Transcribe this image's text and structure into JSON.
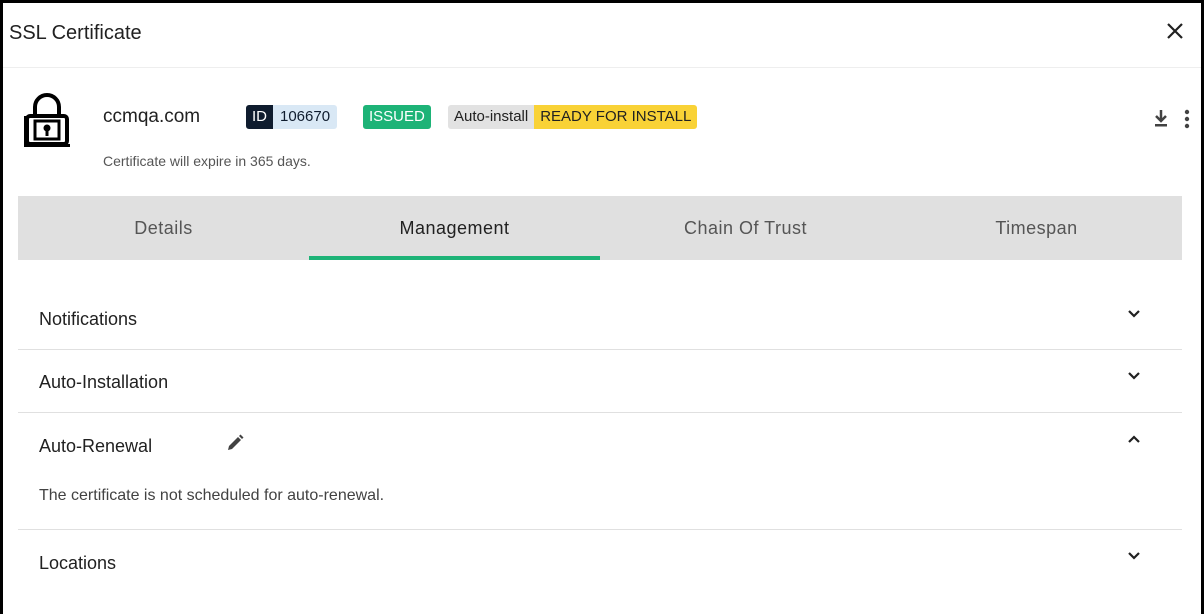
{
  "dialog": {
    "title": "SSL Certificate"
  },
  "certificate": {
    "domain": "ccmqa.com",
    "id_label": "ID",
    "id_value": "106670",
    "status": "ISSUED",
    "auto_install_label": "Auto-install",
    "auto_install_status": "READY FOR INSTALL",
    "expiry_text": "Certificate will expire in 365 days."
  },
  "tabs": [
    {
      "label": "Details",
      "active": false
    },
    {
      "label": "Management",
      "active": true
    },
    {
      "label": "Chain Of Trust",
      "active": false
    },
    {
      "label": "Timespan",
      "active": false
    }
  ],
  "sections": {
    "notifications": {
      "title": "Notifications",
      "expanded": false
    },
    "auto_installation": {
      "title": "Auto-Installation",
      "expanded": false
    },
    "auto_renewal": {
      "title": "Auto-Renewal",
      "expanded": true,
      "body": "The certificate is not scheduled for auto-renewal."
    },
    "locations": {
      "title": "Locations",
      "expanded": false
    }
  },
  "colors": {
    "accent": "#1db377",
    "issued_badge": "#1db377",
    "ready_badge": "#f9d236",
    "id_badge_dark": "#0f1c2e",
    "tab_bar": "#e0e0e0"
  },
  "icons": [
    "close-icon",
    "lock-icon",
    "download-icon",
    "more-vert-icon",
    "chevron-down-icon",
    "chevron-up-icon",
    "pencil-icon"
  ]
}
